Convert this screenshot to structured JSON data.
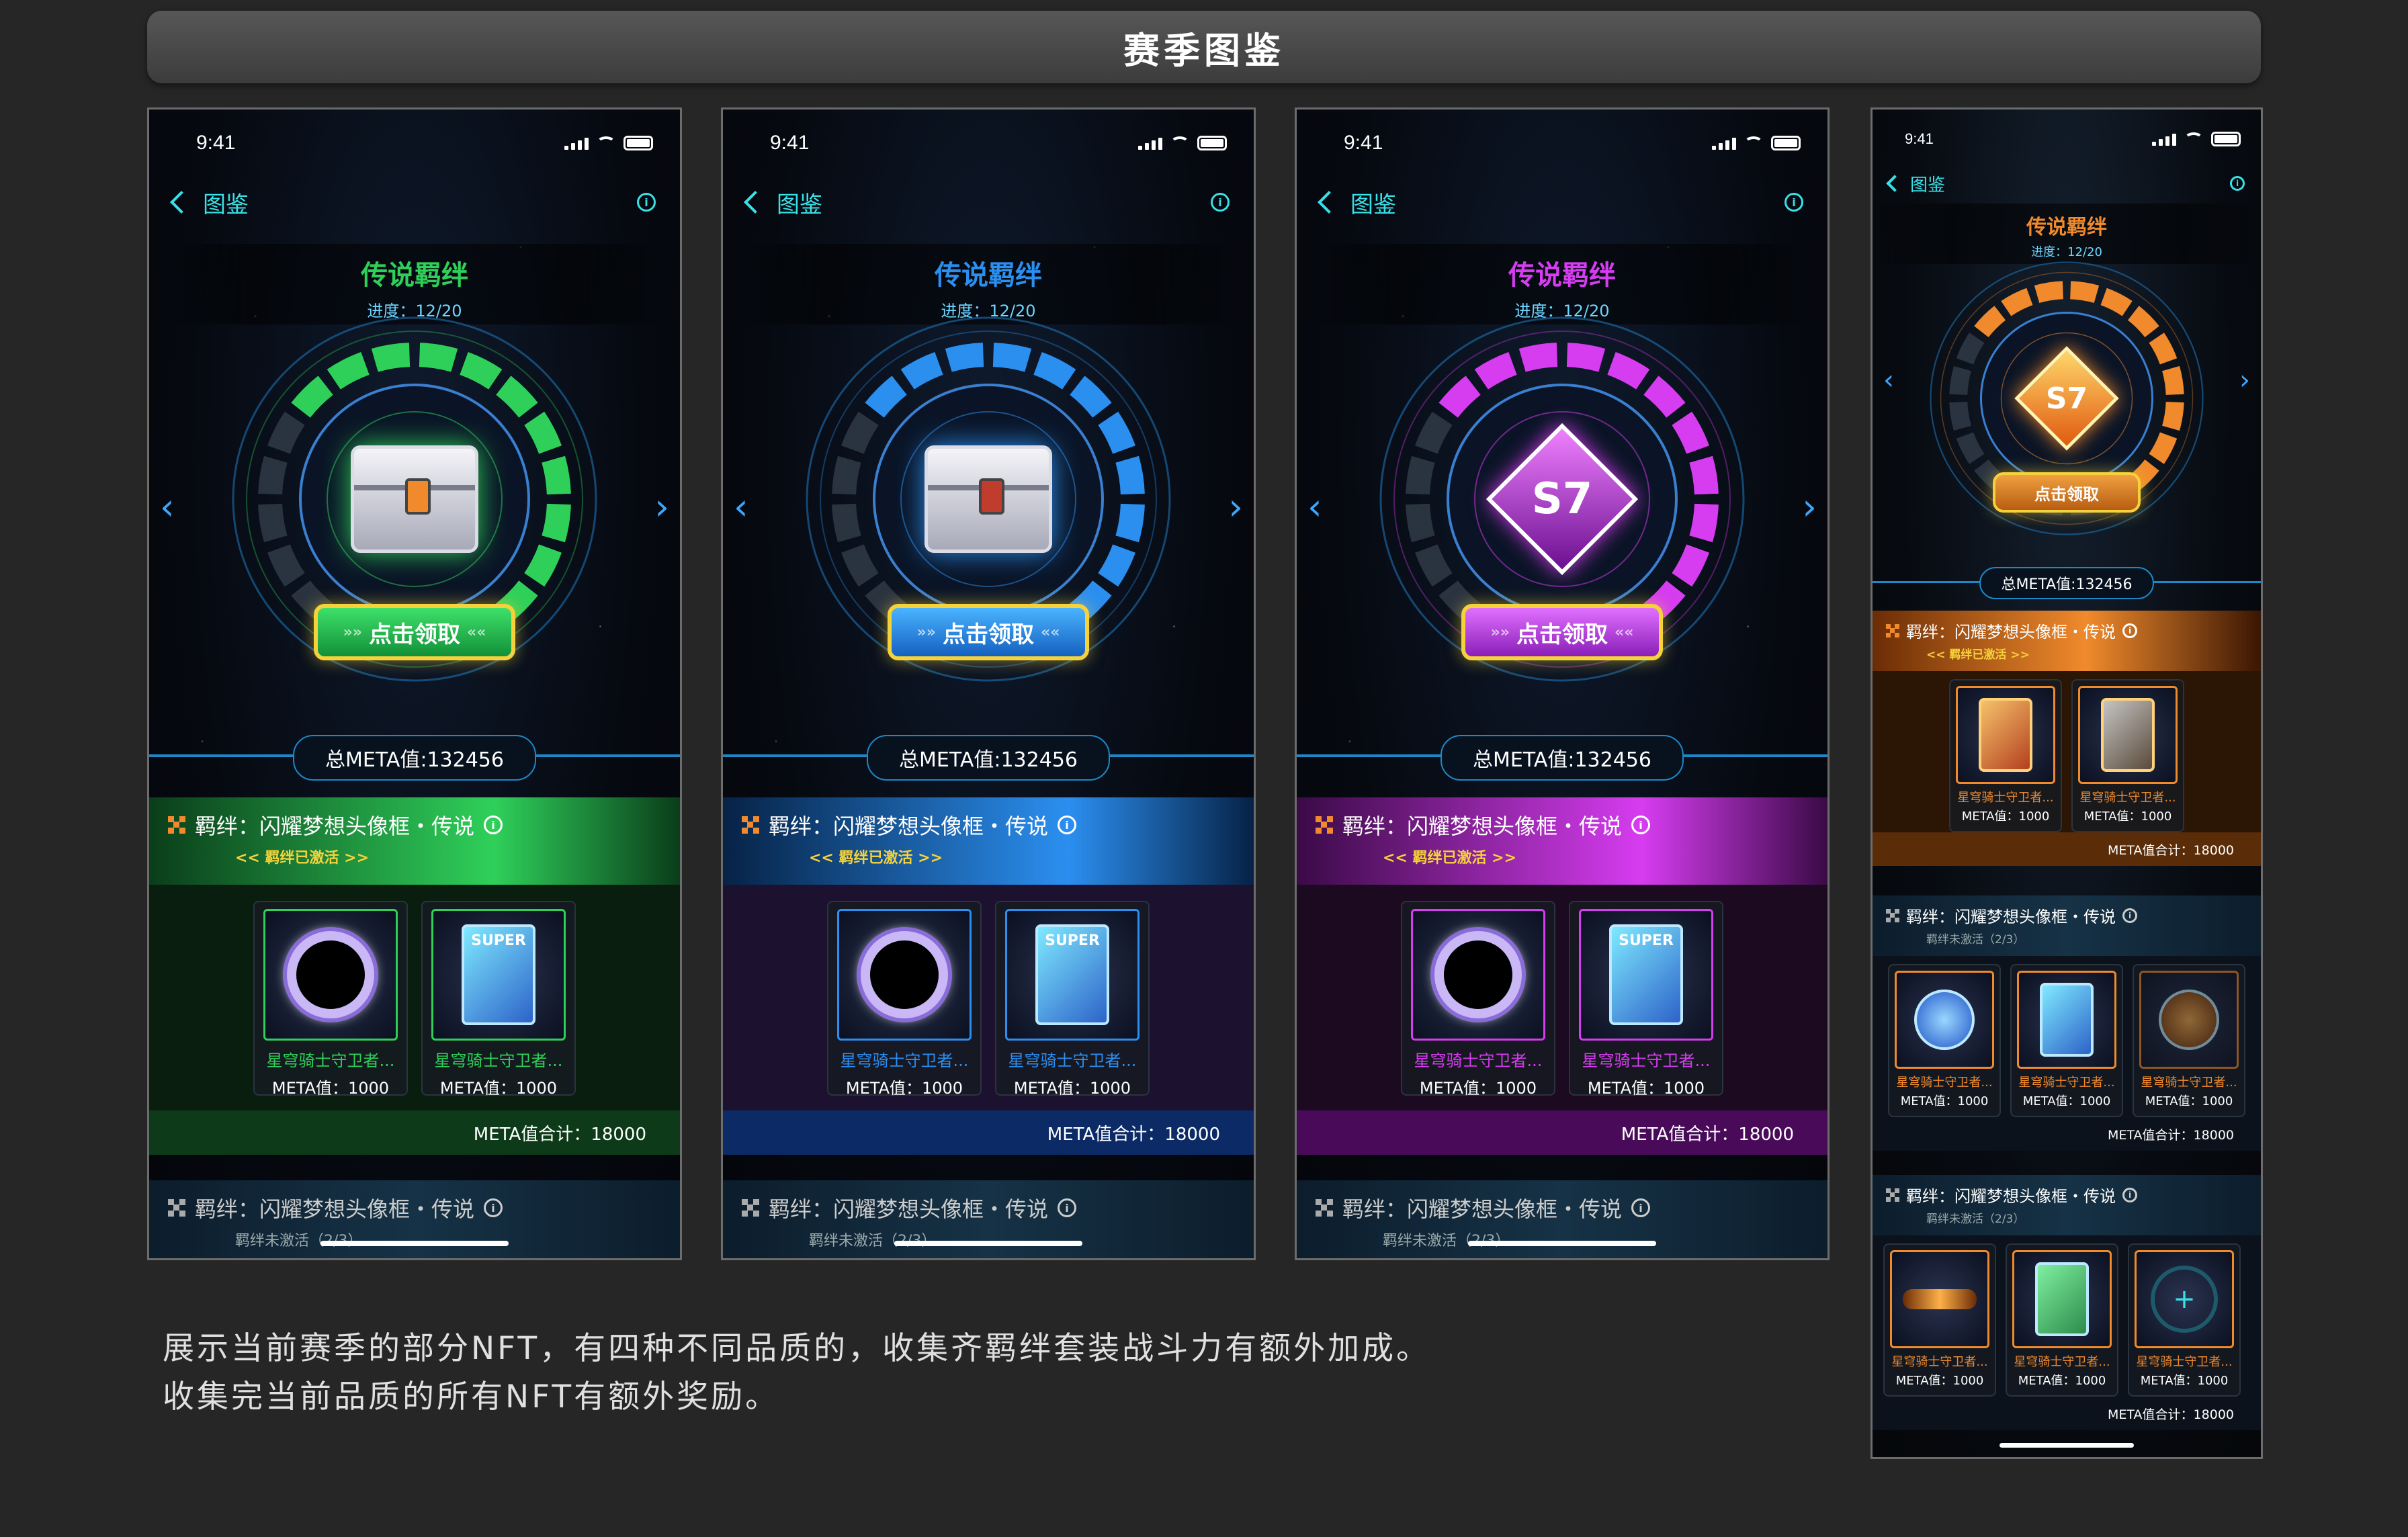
{
  "page_title": "赛季图鉴",
  "status": {
    "time": "9:41"
  },
  "nav": {
    "back_label": "图鉴",
    "info_glyph": "i"
  },
  "header": {
    "title": "传说羁绊",
    "progress": "进度：12/20"
  },
  "claim_label": "点击领取",
  "total_meta": "总META值:132456",
  "bond_active": {
    "title": "羁绊：闪耀梦想头像框・传说",
    "status": "<< 羁绊已激活 >>",
    "items": [
      {
        "name": "星穹骑士守卫者...",
        "meta": "META值：1000"
      },
      {
        "name": "星穹骑士守卫者...",
        "meta": "META值：1000"
      }
    ],
    "sum": "META值合计：18000"
  },
  "bond_inactive": {
    "title": "羁绊：闪耀梦想头像框・传说",
    "status": "羁绊未激活（2/3）"
  },
  "phone4": {
    "bond2_items": [
      {
        "name": "星穹骑士守卫者...",
        "meta": "META值：1000"
      },
      {
        "name": "星穹骑士守卫者...",
        "meta": "META值：1000"
      },
      {
        "name": "星穹骑士守卫者...",
        "meta": "META值：1000"
      }
    ],
    "bond3_items": [
      {
        "name": "星穹骑士守卫者...",
        "meta": "META值：1000"
      },
      {
        "name": "星穹骑士守卫者...",
        "meta": "META值：1000"
      },
      {
        "name": "星穹骑士守卫者...",
        "meta": "META值：1000"
      }
    ],
    "add_glyph": "+"
  },
  "badge_text": "S7",
  "card_text": "SUPER",
  "themes": {
    "green": "#2fd05a",
    "blue": "#2b8ff0",
    "purple": "#d63cf0",
    "orange": "#f08a2c"
  },
  "description": [
    "展示当前赛季的部分NFT，有四种不同品质的，收集齐羁绊套装战斗力有额外加成。",
    "收集完当前品质的所有NFT有额外奖励。"
  ]
}
